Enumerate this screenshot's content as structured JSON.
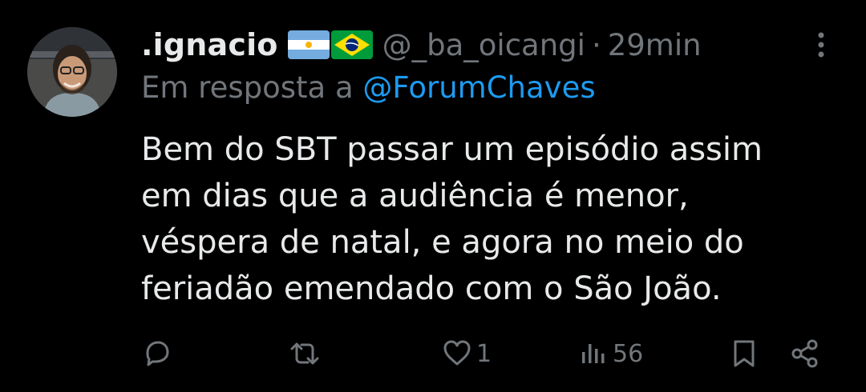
{
  "author": {
    "display_name": ".ignacio",
    "flags": [
      "flag-argentina-icon",
      "flag-brazil-icon"
    ],
    "handle": "@_ba_oicangi",
    "separator": "·",
    "time": "29min"
  },
  "reply_context": {
    "prefix": "Em resposta a",
    "mention": "@ForumChaves"
  },
  "body": {
    "lines": [
      "Bem do SBT passar um episódio assim",
      "em dias que a audiência é menor,",
      "véspera de natal, e agora no meio do",
      "feriadão emendado com o São João."
    ]
  },
  "actions": {
    "reply": {
      "icon": "reply-icon",
      "count": ""
    },
    "retweet": {
      "icon": "retweet-icon",
      "count": ""
    },
    "like": {
      "icon": "heart-icon",
      "count": "1"
    },
    "views": {
      "icon": "views-icon",
      "count": "56"
    },
    "bookmark": {
      "icon": "bookmark-icon"
    },
    "share": {
      "icon": "share-icon"
    }
  },
  "colors": {
    "background": "#000000",
    "text": "#e7e9ea",
    "secondary": "#71767b",
    "accent": "#1d9bf0"
  }
}
